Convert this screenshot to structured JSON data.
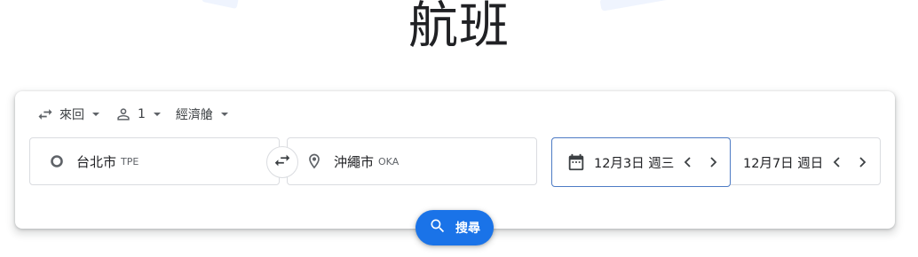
{
  "page": {
    "title": "航班"
  },
  "trip_type": {
    "value": "來回",
    "icon": "swap-horiz-icon"
  },
  "passengers": {
    "count": "1",
    "icon": "person-icon"
  },
  "cabin_class": {
    "value": "經濟艙"
  },
  "origin": {
    "city": "台北市",
    "code": "TPE",
    "icon": "circle-icon"
  },
  "destination": {
    "city": "沖繩市",
    "code": "OKA",
    "icon": "location-pin-icon"
  },
  "departure_date": {
    "value": "12月3日 週三",
    "icon": "calendar-icon"
  },
  "return_date": {
    "value": "12月7日 週日"
  },
  "search_button": {
    "label": "搜尋",
    "icon": "search-icon"
  },
  "colors": {
    "accent": "#1a73e8",
    "focus_border": "#4d7bc4",
    "border": "#dadce0",
    "text_primary": "#202124",
    "text_secondary": "#5f6368"
  }
}
